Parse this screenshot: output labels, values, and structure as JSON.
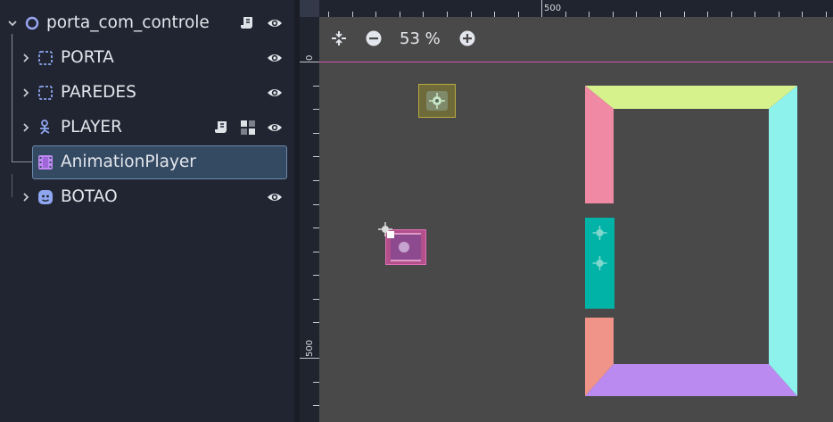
{
  "scene_tree": {
    "root": {
      "label": "porta_com_controle"
    },
    "nodes": [
      {
        "label": "PORTA",
        "icon": "control-node-icon"
      },
      {
        "label": "PAREDES",
        "icon": "control-node-icon"
      },
      {
        "label": "PLAYER",
        "icon": "character-body-icon"
      },
      {
        "label": "AnimationPlayer",
        "icon": "animation-player-icon"
      },
      {
        "label": "BOTAO",
        "icon": "button-node-icon"
      }
    ]
  },
  "viewport": {
    "zoom_label": "53 %",
    "ruler_top_label": "500",
    "ruler_left_zero": "0",
    "ruler_left_label": "500"
  },
  "colors": {
    "wall_top": "#d6f28c",
    "wall_left_upper": "#f08aa4",
    "wall_left_lower": "#f0948a",
    "wall_right": "#8ef2ec",
    "wall_bottom": "#bb8af0",
    "door": "#00b3a6",
    "axis_x": "#d24fb1",
    "selection": "#344a63"
  }
}
